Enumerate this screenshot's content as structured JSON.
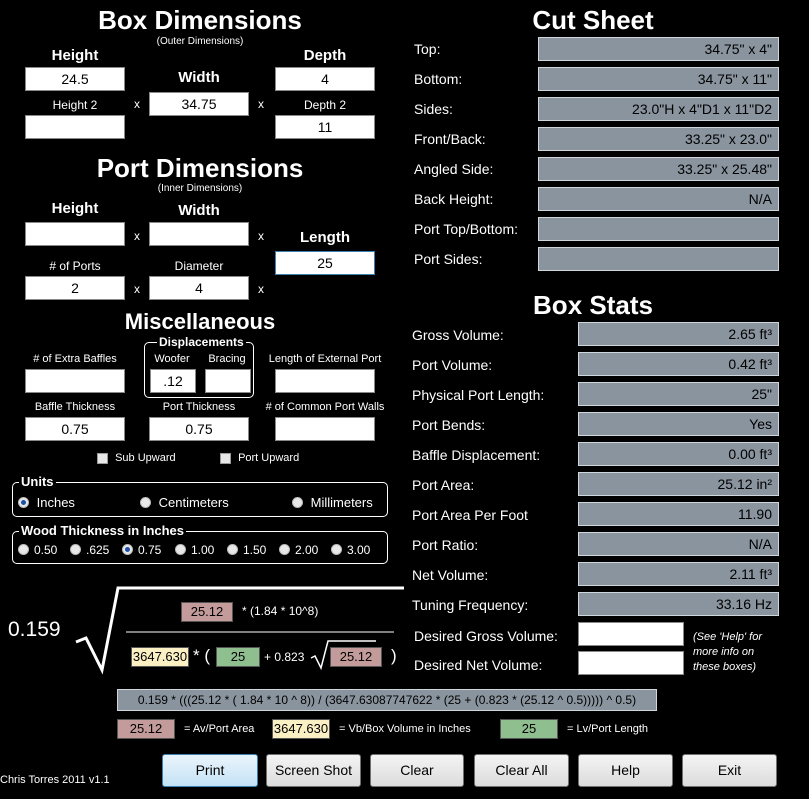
{
  "box_dimensions": {
    "title": "Box Dimensions",
    "subtitle": "(Outer Dimensions)",
    "height_label": "Height",
    "height_value": "24.5",
    "height2_label": "Height 2",
    "height2_value": "",
    "width_label": "Width",
    "width_value": "34.75",
    "depth_label": "Depth",
    "depth_value": "4",
    "depth2_label": "Depth 2",
    "depth2_value": "11",
    "times": "x"
  },
  "port_dimensions": {
    "title": "Port Dimensions",
    "subtitle": "(Inner Dimensions)",
    "height_label": "Height",
    "height_value": "",
    "width_label": "Width",
    "width_value": "",
    "length_label": "Length",
    "length_value": "25",
    "ports_label": "# of Ports",
    "ports_value": "2",
    "diameter_label": "Diameter",
    "diameter_value": "4"
  },
  "misc": {
    "title": "Miscellaneous",
    "extra_baffles_label": "# of Extra Baffles",
    "extra_baffles_value": "",
    "displacements_title": "Displacements",
    "woofer_label": "Woofer",
    "woofer_value": ".12",
    "bracing_label": "Bracing",
    "bracing_value": "",
    "ext_port_label": "Length of External Port",
    "ext_port_value": "",
    "baffle_thickness_label": "Baffle Thickness",
    "baffle_thickness_value": "0.75",
    "port_thickness_label": "Port Thickness",
    "port_thickness_value": "0.75",
    "common_walls_label": "# of Common Port Walls",
    "common_walls_value": "",
    "sub_upward_label": "Sub Upward",
    "port_upward_label": "Port Upward"
  },
  "units": {
    "title": "Units",
    "options": [
      "Inches",
      "Centimeters",
      "Millimeters"
    ],
    "selected": "Inches"
  },
  "wood": {
    "title": "Wood Thickness in Inches",
    "options": [
      "0.50",
      ".625",
      "0.75",
      "1.00",
      "1.50",
      "2.00",
      "3.00"
    ],
    "selected": "0.75"
  },
  "formula": {
    "coefficient": "0.159",
    "av": "25.12",
    "numerator_rest": "* (1.84 * 10^8)",
    "vb": "3647.630",
    "open_paren": "* (",
    "lv": "25",
    "plus": "+ 0.823",
    "av2": "25.12",
    "close_paren": ")",
    "expression": "0.159 * (((25.12 * ( 1.84 * 10 ^ 8)) / (3647.63087747622 * (25 + (0.823 * (25.12 ^ 0.5))))) ^ 0.5)"
  },
  "legend": {
    "av_value": "25.12",
    "av_label": "= Av/Port Area",
    "vb_value": "3647.630",
    "vb_label": "= Vb/Box Volume in Inches",
    "lv_value": "25",
    "lv_label": "= Lv/Port Length"
  },
  "cut_sheet": {
    "title": "Cut Sheet",
    "rows": [
      {
        "label": "Top:",
        "value": "34.75\" x 4\""
      },
      {
        "label": "Bottom:",
        "value": "34.75\" x 11\""
      },
      {
        "label": "Sides:",
        "value": "23.0\"H x 4\"D1 x 11\"D2"
      },
      {
        "label": "Front/Back:",
        "value": "33.25\" x 23.0\""
      },
      {
        "label": "Angled Side:",
        "value": "33.25\" x 25.48\""
      },
      {
        "label": "Back Height:",
        "value": "N/A"
      },
      {
        "label": "Port Top/Bottom:",
        "value": ""
      },
      {
        "label": "Port Sides:",
        "value": ""
      }
    ]
  },
  "box_stats": {
    "title": "Box Stats",
    "rows": [
      {
        "label": "Gross Volume:",
        "value": "2.65 ft³"
      },
      {
        "label": "Port Volume:",
        "value": "0.42 ft³"
      },
      {
        "label": "Physical Port Length:",
        "value": "25\""
      },
      {
        "label": "Port Bends:",
        "value": "Yes"
      },
      {
        "label": "Baffle Displacement:",
        "value": "0.00 ft³"
      },
      {
        "label": "Port Area:",
        "value": "25.12 in²"
      },
      {
        "label": "Port Area Per Foot",
        "value": "11.90"
      },
      {
        "label": "Port Ratio:",
        "value": "N/A"
      },
      {
        "label": "Net Volume:",
        "value": "2.11 ft³"
      },
      {
        "label": "Tuning Frequency:",
        "value": "33.16 Hz"
      }
    ],
    "desired_gross_label": "Desired Gross Volume:",
    "desired_gross_value": "",
    "desired_net_label": "Desired Net Volume:",
    "desired_net_value": "",
    "help_note": "(See 'Help' for more info on these boxes)"
  },
  "footer": {
    "credit": "Chris Torres 2011 v1.1",
    "buttons": [
      "Print",
      "Screen Shot",
      "Clear",
      "Clear All",
      "Help",
      "Exit"
    ]
  }
}
